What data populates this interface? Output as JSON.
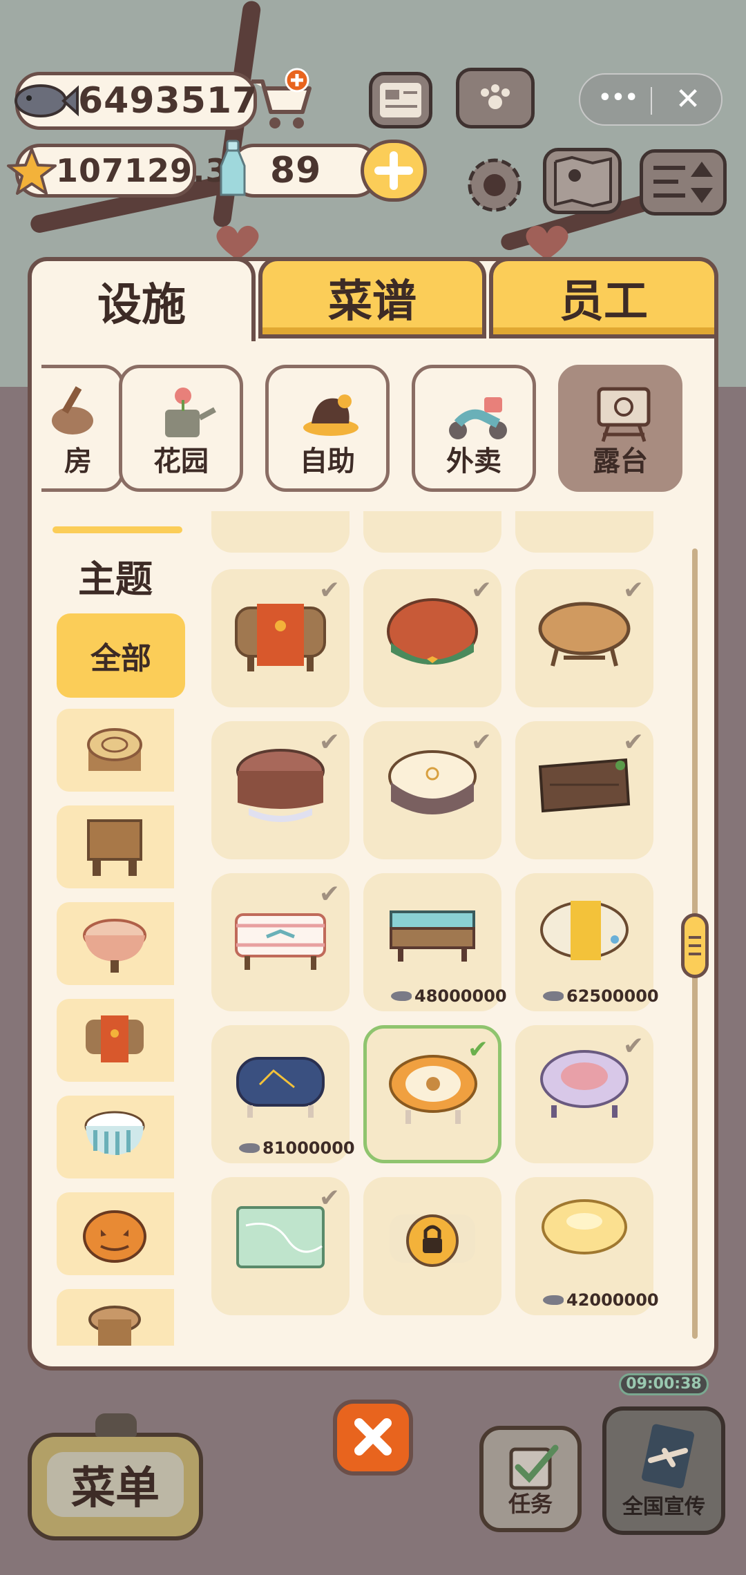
{
  "hud": {
    "fish_count": "6493517",
    "star_count": "107129.3",
    "bottle_count": "89"
  },
  "mini_program": {
    "more_label": "•••",
    "close_label": "✕"
  },
  "tabs": [
    {
      "label": "设施",
      "active": true
    },
    {
      "label": "菜谱",
      "active": false
    },
    {
      "label": "员工",
      "active": false
    }
  ],
  "categories": [
    {
      "label": "房",
      "icon": "kitchen-icon",
      "active": false
    },
    {
      "label": "花园",
      "icon": "watering-can-icon",
      "active": false
    },
    {
      "label": "自助",
      "icon": "buffet-icon",
      "active": false
    },
    {
      "label": "外卖",
      "icon": "scooter-icon",
      "active": false
    },
    {
      "label": "露台",
      "icon": "easel-icon",
      "active": true
    }
  ],
  "sidebar": {
    "title": "主题",
    "all_label": "全部",
    "themes": [
      "log-stump-icon",
      "wooden-table-icon",
      "checkered-table-icon",
      "paw-cloth-table-icon",
      "striped-table-icon",
      "pumpkin-icon",
      "round-stool-icon"
    ]
  },
  "items": [
    {
      "name": "paw-print-cloth-table",
      "owned": true,
      "price": ""
    },
    {
      "name": "plaid-round-table",
      "owned": true,
      "price": ""
    },
    {
      "name": "oval-wood-table",
      "owned": true,
      "price": ""
    },
    {
      "name": "chocolate-cake-table",
      "owned": true,
      "price": ""
    },
    {
      "name": "cream-round-table",
      "owned": true,
      "price": ""
    },
    {
      "name": "plank-table",
      "owned": true,
      "price": ""
    },
    {
      "name": "pink-ribbon-table",
      "owned": true,
      "price": ""
    },
    {
      "name": "teal-bench-table",
      "owned": false,
      "price": "48000000"
    },
    {
      "name": "fish-banner-table",
      "owned": false,
      "price": "62500000"
    },
    {
      "name": "starry-blue-table",
      "owned": false,
      "price": "81000000"
    },
    {
      "name": "bear-face-table",
      "owned": true,
      "price": "",
      "selected": true
    },
    {
      "name": "lavender-round-table",
      "owned": true,
      "price": ""
    },
    {
      "name": "mint-marble-table",
      "owned": true,
      "price": ""
    },
    {
      "name": "locked-table",
      "owned": false,
      "locked": true,
      "price": ""
    },
    {
      "name": "lemon-round-table",
      "owned": false,
      "price": "42000000"
    }
  ],
  "timer": "09:00:38",
  "bottom": {
    "menu_label": "菜单",
    "task_label": "任务",
    "promo_label": "全国宣传"
  },
  "colors": {
    "accent": "#fbcd58",
    "panel": "#fbf3e6",
    "border": "#6b4f49",
    "close": "#e8641e"
  }
}
